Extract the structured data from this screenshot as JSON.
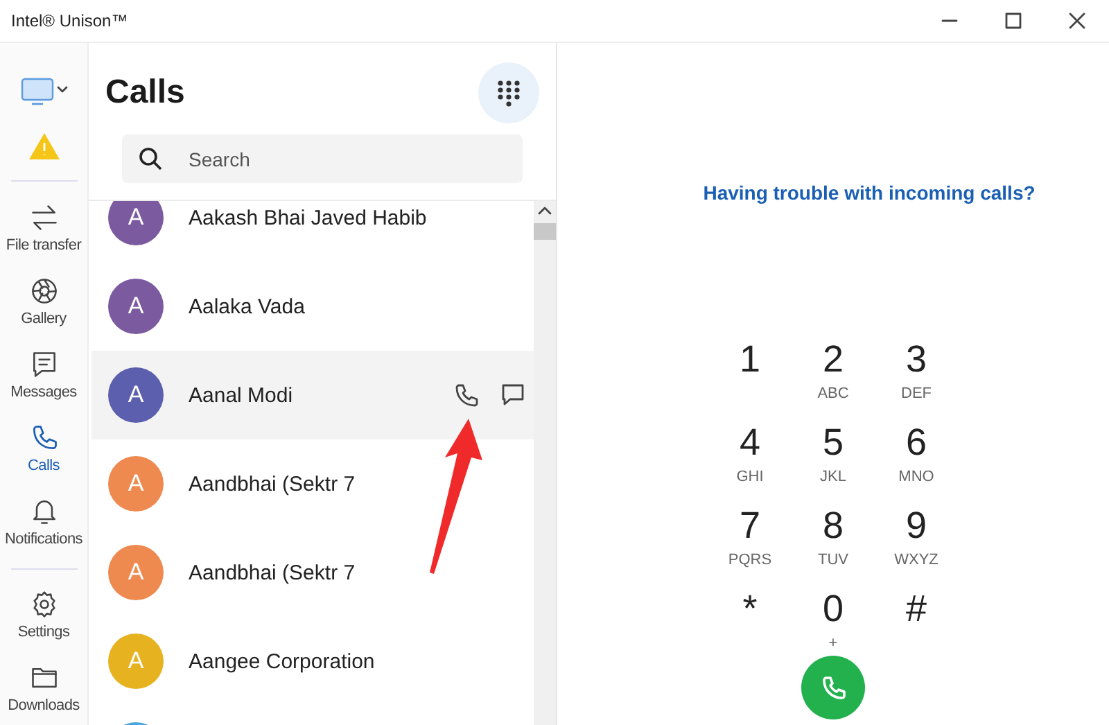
{
  "window": {
    "title": "Intel® Unison™"
  },
  "sidebar": {
    "items": [
      {
        "kind": "device"
      },
      {
        "kind": "warning"
      },
      {
        "kind": "transfer",
        "label": "File transfer",
        "selected": false
      },
      {
        "kind": "gallery",
        "label": "Gallery",
        "selected": false
      },
      {
        "kind": "messages",
        "label": "Messages",
        "selected": false
      },
      {
        "kind": "calls",
        "label": "Calls",
        "selected": true
      },
      {
        "kind": "notifications",
        "label": "Notifications",
        "selected": false
      },
      {
        "kind": "settings",
        "label": "Settings",
        "selected": false
      },
      {
        "kind": "downloads",
        "label": "Downloads",
        "selected": false
      }
    ]
  },
  "contacts": {
    "title": "Calls",
    "search": {
      "placeholder": "Search"
    },
    "items": [
      {
        "initial": "A",
        "name": "Aakash Bhai Javed Habib",
        "color": "#7b5aa0",
        "selected": false
      },
      {
        "initial": "A",
        "name": "Aalaka Vada",
        "color": "#7b5aa0",
        "selected": false
      },
      {
        "initial": "A",
        "name": "Aanal Modi",
        "color": "#5b5fad",
        "selected": true
      },
      {
        "initial": "A",
        "name": "Aandbhai (Sektr 7",
        "color": "#ee8a50",
        "selected": false
      },
      {
        "initial": "A",
        "name": "Aandbhai (Sektr 7",
        "color": "#ee8a50",
        "selected": false
      },
      {
        "initial": "A",
        "name": "Aangee Corporation",
        "color": "#e6b21f",
        "selected": false
      },
      {
        "color": "#4ea6d8",
        "selected": false
      }
    ]
  },
  "dialer": {
    "help_link": "Having trouble with incoming calls?",
    "keys": [
      {
        "digit": "1"
      },
      {
        "digit": "2",
        "letters": "ABC"
      },
      {
        "digit": "3",
        "letters": "DEF"
      },
      {
        "digit": "4",
        "letters": "GHI"
      },
      {
        "digit": "5",
        "letters": "JKL"
      },
      {
        "digit": "6",
        "letters": "MNO"
      },
      {
        "digit": "7",
        "letters": "PQRS"
      },
      {
        "digit": "8",
        "letters": "TUV"
      },
      {
        "digit": "9",
        "letters": "WXYZ"
      },
      {
        "digit": "*"
      },
      {
        "digit": "0",
        "letters": "+"
      },
      {
        "digit": "#"
      }
    ]
  }
}
